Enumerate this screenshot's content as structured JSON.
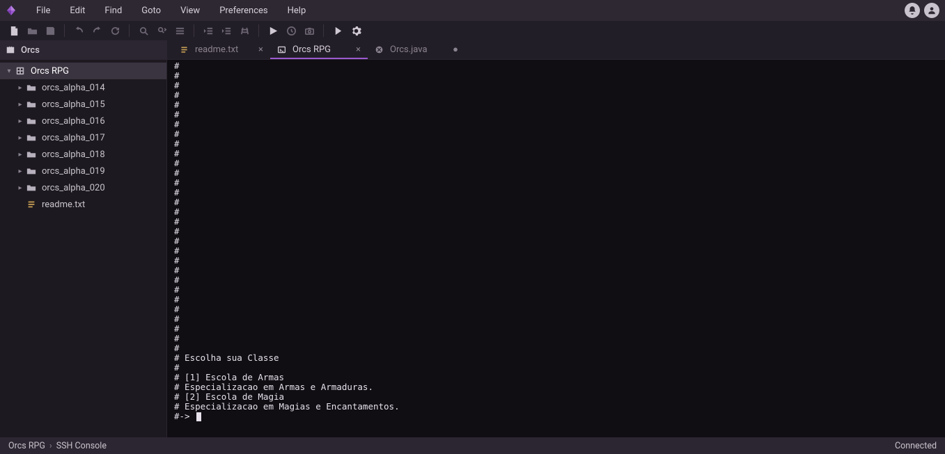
{
  "menu": {
    "items": [
      "File",
      "Edit",
      "Find",
      "Goto",
      "View",
      "Preferences",
      "Help"
    ]
  },
  "sidebar": {
    "project_header": "Orcs",
    "root": {
      "label": "Orcs RPG",
      "expanded": true
    },
    "folders": [
      {
        "label": "orcs_alpha_014"
      },
      {
        "label": "orcs_alpha_015"
      },
      {
        "label": "orcs_alpha_016"
      },
      {
        "label": "orcs_alpha_017"
      },
      {
        "label": "orcs_alpha_018"
      },
      {
        "label": "orcs_alpha_019"
      },
      {
        "label": "orcs_alpha_020"
      }
    ],
    "file": {
      "label": "readme.txt"
    }
  },
  "tabs": {
    "items": [
      {
        "label": "readme.txt",
        "type": "text",
        "active": false,
        "dirty": false
      },
      {
        "label": "Orcs RPG",
        "type": "terminal",
        "active": true,
        "dirty": false
      },
      {
        "label": "Orcs.java",
        "type": "code",
        "active": false,
        "dirty": true
      }
    ]
  },
  "console": {
    "hash_lines": 30,
    "body": [
      "# Escolha sua Classe",
      "#",
      "# [1] Escola de Armas",
      "# Especializacao em Armas e Armaduras.",
      "",
      "# [2] Escola de Magia",
      "# Especializacao em Magias e Encantamentos."
    ],
    "prompt": "#-> "
  },
  "status": {
    "crumb1": "Orcs RPG",
    "crumb2": "SSH Console",
    "right": "Connected"
  }
}
